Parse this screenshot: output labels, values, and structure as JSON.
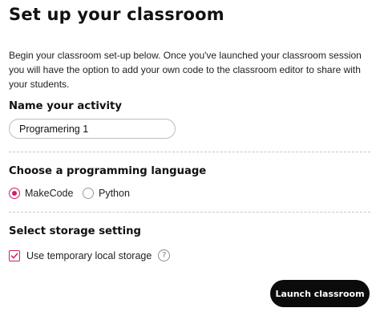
{
  "page": {
    "title": "Set up your classroom",
    "intro": "Begin your classroom set-up below. Once you've launched your classroom session you will have the option to add your own code to the classroom editor to share with your students."
  },
  "activity": {
    "heading": "Name your activity",
    "value": "Programering 1"
  },
  "language": {
    "heading": "Choose a programming language",
    "options": [
      {
        "label": "MakeCode",
        "selected": true
      },
      {
        "label": "Python",
        "selected": false
      }
    ]
  },
  "storage": {
    "heading": "Select storage setting",
    "checkbox_label": "Use temporary local storage",
    "checked": true,
    "help_icon_glyph": "?"
  },
  "actions": {
    "launch_label": "Launch classroom"
  },
  "colors": {
    "accent": "#d11a6a",
    "button_bg": "#0b0b0b"
  }
}
